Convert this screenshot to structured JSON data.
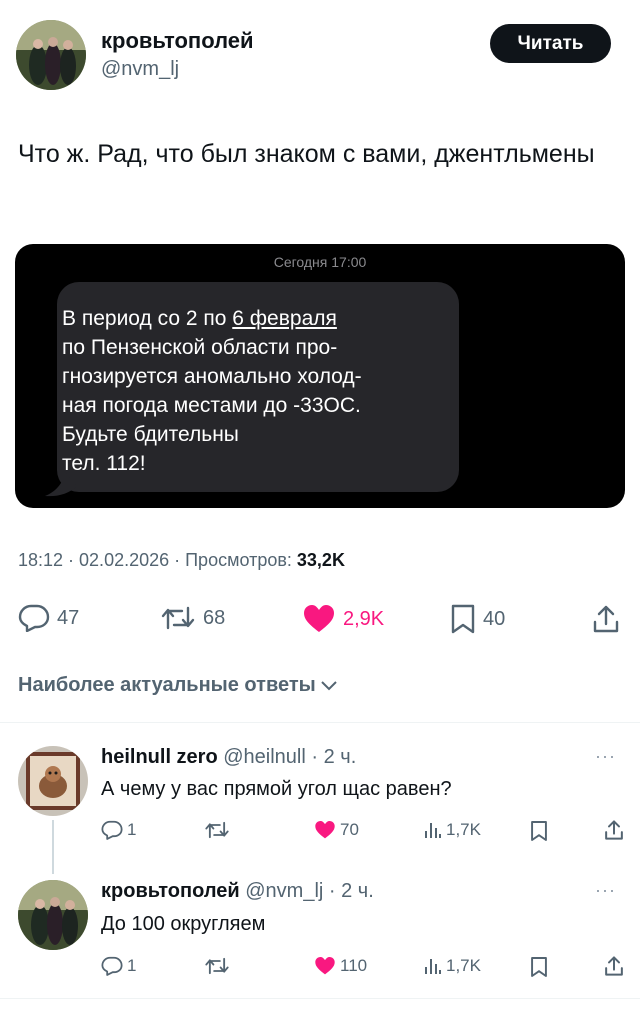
{
  "author": {
    "name": "кровьтополей",
    "handle": "@nvm_lj"
  },
  "follow_button": "Читать",
  "tweet": {
    "text": "Что ж. Рад, что был знаком с вами, джентльмены"
  },
  "sms": {
    "time": "Сегодня 17:00",
    "lines": [
      "В период со 2 по ",
      "по Пензенской области про-",
      "гнозируется аномально холод-",
      "ная погода местами до -33ОС.",
      "Будьте бдительны",
      "тел. 112!"
    ],
    "date_link": "6 февраля"
  },
  "meta": {
    "time_date": "18:12 · 02.02.2026 · Просмотров: ",
    "views": "33,2K"
  },
  "actions": {
    "replies": "47",
    "reposts": "68",
    "likes": "2,9K",
    "bookmarks": "40"
  },
  "section_title": "Наиболее актуальные ответы",
  "replies": [
    {
      "name": "heilnull zero",
      "handle_time": "@heilnull · 2 ч.",
      "text": "А чему у вас прямой угол щас равен?",
      "replies": "1",
      "likes": "70",
      "views": "1,7K"
    },
    {
      "name": "кровьтополей",
      "handle_time": "@nvm_lj · 2 ч.",
      "text": "До 100 округляем",
      "replies": "1",
      "likes": "110",
      "views": "1,7K"
    }
  ],
  "colors": {
    "like": "#f91880",
    "secondary_text": "#536471",
    "button": "#0f1419"
  }
}
